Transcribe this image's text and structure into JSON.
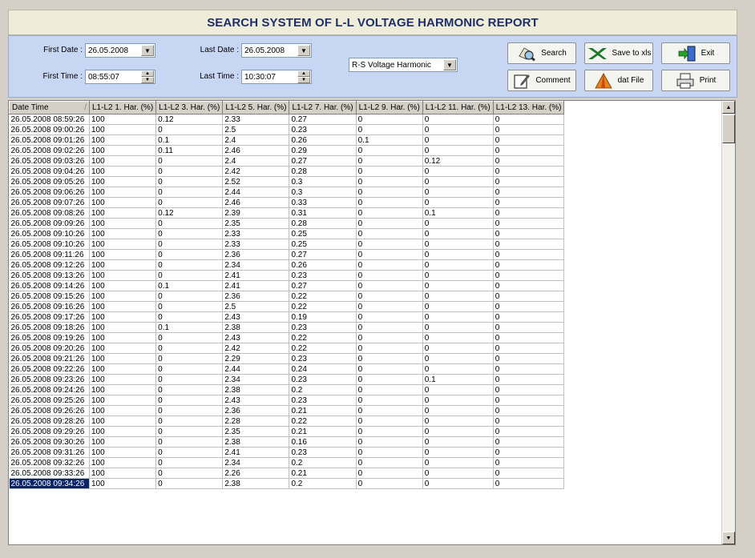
{
  "title": "SEARCH SYSTEM OF L-L VOLTAGE HARMONIC REPORT",
  "filters": {
    "first_date_label": "First Date :",
    "first_date": "26.05.2008",
    "last_date_label": "Last Date :",
    "last_date": "26.05.2008",
    "first_time_label": "First Time :",
    "first_time": "08:55:07",
    "last_time_label": "Last Time :",
    "last_time": "10:30:07",
    "report_type": "R-S Voltage Harmonic"
  },
  "buttons": {
    "search": "Search",
    "save_xls": "Save to xls",
    "exit": "Exit",
    "comment": "Comment",
    "dat_file": "dat File",
    "print": "Print"
  },
  "icons": {
    "search": "search-binoculars-icon",
    "save_xls": "excel-icon",
    "exit": "exit-door-icon",
    "comment": "comment-edit-icon",
    "dat_file": "dat-file-icon",
    "print": "printer-icon"
  },
  "grid": {
    "columns": [
      "Date Time",
      "L1-L2 1. Har. (%)",
      "L1-L2 3. Har. (%)",
      "L1-L2 5. Har. (%)",
      "L1-L2 7. Har. (%)",
      "L1-L2 9. Har. (%)",
      "L1-L2 11. Har. (%)",
      "L1-L2 13. Har. (%)"
    ],
    "sort_indicator": "/",
    "rows": [
      [
        "26.05.2008 08:59:26",
        "100",
        "0.12",
        "2.33",
        "0.27",
        "0",
        "0",
        "0"
      ],
      [
        "26.05.2008 09:00:26",
        "100",
        "0",
        "2.5",
        "0.23",
        "0",
        "0",
        "0"
      ],
      [
        "26.05.2008 09:01:26",
        "100",
        "0.1",
        "2.4",
        "0.26",
        "0.1",
        "0",
        "0"
      ],
      [
        "26.05.2008 09:02:26",
        "100",
        "0.11",
        "2.46",
        "0.29",
        "0",
        "0",
        "0"
      ],
      [
        "26.05.2008 09:03:26",
        "100",
        "0",
        "2.4",
        "0.27",
        "0",
        "0.12",
        "0"
      ],
      [
        "26.05.2008 09:04:26",
        "100",
        "0",
        "2.42",
        "0.28",
        "0",
        "0",
        "0"
      ],
      [
        "26.05.2008 09:05:26",
        "100",
        "0",
        "2.52",
        "0.3",
        "0",
        "0",
        "0"
      ],
      [
        "26.05.2008 09:06:26",
        "100",
        "0",
        "2.44",
        "0.3",
        "0",
        "0",
        "0"
      ],
      [
        "26.05.2008 09:07:26",
        "100",
        "0",
        "2.46",
        "0.33",
        "0",
        "0",
        "0"
      ],
      [
        "26.05.2008 09:08:26",
        "100",
        "0.12",
        "2.39",
        "0.31",
        "0",
        "0.1",
        "0"
      ],
      [
        "26.05.2008 09:09:26",
        "100",
        "0",
        "2.35",
        "0.28",
        "0",
        "0",
        "0"
      ],
      [
        "26.05.2008 09:10:26",
        "100",
        "0",
        "2.33",
        "0.25",
        "0",
        "0",
        "0"
      ],
      [
        "26.05.2008 09:10:26",
        "100",
        "0",
        "2.33",
        "0.25",
        "0",
        "0",
        "0"
      ],
      [
        "26.05.2008 09:11:26",
        "100",
        "0",
        "2.36",
        "0.27",
        "0",
        "0",
        "0"
      ],
      [
        "26.05.2008 09:12:26",
        "100",
        "0",
        "2.34",
        "0.26",
        "0",
        "0",
        "0"
      ],
      [
        "26.05.2008 09:13:26",
        "100",
        "0",
        "2.41",
        "0.23",
        "0",
        "0",
        "0"
      ],
      [
        "26.05.2008 09:14:26",
        "100",
        "0.1",
        "2.41",
        "0.27",
        "0",
        "0",
        "0"
      ],
      [
        "26.05.2008 09:15:26",
        "100",
        "0",
        "2.36",
        "0.22",
        "0",
        "0",
        "0"
      ],
      [
        "26.05.2008 09:16:26",
        "100",
        "0",
        "2.5",
        "0.22",
        "0",
        "0",
        "0"
      ],
      [
        "26.05.2008 09:17:26",
        "100",
        "0",
        "2.43",
        "0.19",
        "0",
        "0",
        "0"
      ],
      [
        "26.05.2008 09:18:26",
        "100",
        "0.1",
        "2.38",
        "0.23",
        "0",
        "0",
        "0"
      ],
      [
        "26.05.2008 09:19:26",
        "100",
        "0",
        "2.43",
        "0.22",
        "0",
        "0",
        "0"
      ],
      [
        "26.05.2008 09:20:26",
        "100",
        "0",
        "2.42",
        "0.22",
        "0",
        "0",
        "0"
      ],
      [
        "26.05.2008 09:21:26",
        "100",
        "0",
        "2.29",
        "0.23",
        "0",
        "0",
        "0"
      ],
      [
        "26.05.2008 09:22:26",
        "100",
        "0",
        "2.44",
        "0.24",
        "0",
        "0",
        "0"
      ],
      [
        "26.05.2008 09:23:26",
        "100",
        "0",
        "2.34",
        "0.23",
        "0",
        "0.1",
        "0"
      ],
      [
        "26.05.2008 09:24:26",
        "100",
        "0",
        "2.38",
        "0.2",
        "0",
        "0",
        "0"
      ],
      [
        "26.05.2008 09:25:26",
        "100",
        "0",
        "2.43",
        "0.23",
        "0",
        "0",
        "0"
      ],
      [
        "26.05.2008 09:26:26",
        "100",
        "0",
        "2.36",
        "0.21",
        "0",
        "0",
        "0"
      ],
      [
        "26.05.2008 09:28:26",
        "100",
        "0",
        "2.28",
        "0.22",
        "0",
        "0",
        "0"
      ],
      [
        "26.05.2008 09:29:26",
        "100",
        "0",
        "2.35",
        "0.21",
        "0",
        "0",
        "0"
      ],
      [
        "26.05.2008 09:30:26",
        "100",
        "0",
        "2.38",
        "0.16",
        "0",
        "0",
        "0"
      ],
      [
        "26.05.2008 09:31:26",
        "100",
        "0",
        "2.41",
        "0.23",
        "0",
        "0",
        "0"
      ],
      [
        "26.05.2008 09:32:26",
        "100",
        "0",
        "2.34",
        "0.2",
        "0",
        "0",
        "0"
      ],
      [
        "26.05.2008 09:33:26",
        "100",
        "0",
        "2.26",
        "0.21",
        "0",
        "0",
        "0"
      ],
      [
        "26.05.2008 09:34:26",
        "100",
        "0",
        "2.38",
        "0.2",
        "0",
        "0",
        "0"
      ]
    ],
    "selected_row": 35
  },
  "colors": {
    "title_text": "#1f2f6b",
    "panel_bg": "#c7d6f2",
    "selection": "#0a246a"
  }
}
